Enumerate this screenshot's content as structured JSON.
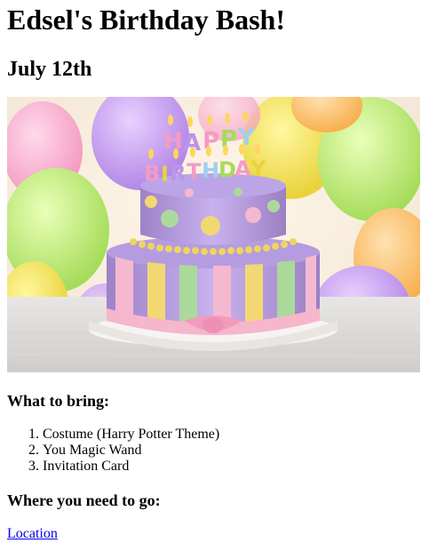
{
  "page": {
    "title": "Edsel's Birthday Bash!",
    "date": "July 12th"
  },
  "image": {
    "subject": "birthday-cake-icon",
    "candle_text": "HAPPY BIRTHDAY",
    "colors": {
      "cake_purple": "#b79ad8",
      "cake_pink": "#f6b6cc",
      "cake_yellow": "#f1d76a",
      "cake_green": "#a9d99a",
      "plate": "#f4f1ee"
    }
  },
  "bring": {
    "heading": "What to bring:",
    "items": [
      "Costume (Harry Potter Theme)",
      "You Magic Wand",
      "Invitation Card"
    ]
  },
  "go": {
    "heading": "Where you need to go:",
    "link_label": "Location"
  }
}
